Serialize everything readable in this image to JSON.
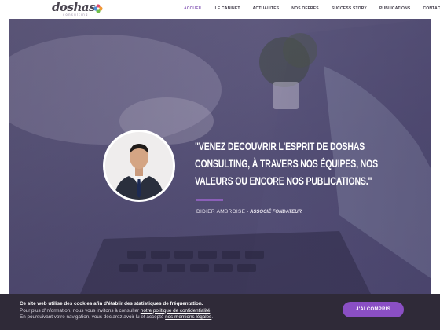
{
  "brand": {
    "logo_text": "doshas",
    "logo_sub": "consulting",
    "colors": {
      "accent": "#8a5fb8",
      "button": "#8a4fc4",
      "cookie_bg": "#2f2a38"
    }
  },
  "nav": {
    "items": [
      {
        "label": "ACCUEIL",
        "active": true
      },
      {
        "label": "LE CABINET",
        "active": false
      },
      {
        "label": "ACTUALITÉS",
        "active": false
      },
      {
        "label": "NOS OFFRES",
        "active": false
      },
      {
        "label": "SUCCESS STORY",
        "active": false
      },
      {
        "label": "PUBLICATIONS",
        "active": false
      },
      {
        "label": "CONTACT",
        "active": false
      }
    ]
  },
  "hero": {
    "quote": "\"VENEZ DÉCOUVRIR L'ESPRIT DE DOSHAS CONSULTING, À TRAVERS NOS ÉQUIPES, NOS VALEURS OU ENCORE NOS PUBLICATIONS.\"",
    "author_name": "DIDIER AMBROISE",
    "separator": " - ",
    "author_role": "ASSOCIÉ FONDATEUR"
  },
  "cookie": {
    "line1": "Ce site web utilise des cookies afin d'établir des statistiques de fréquentation.",
    "line2_prefix": "Pour plus d'information, nous vous invitons à consulter ",
    "line2_link": "notre politique de confidentialité",
    "line2_suffix": ".",
    "line3_prefix": "En poursuivant votre navigation, vous déclarez avoir lu et accepté ",
    "line3_link": "nos mentions légales",
    "line3_suffix": ".",
    "accept_label": "J'AI COMPRIS"
  }
}
